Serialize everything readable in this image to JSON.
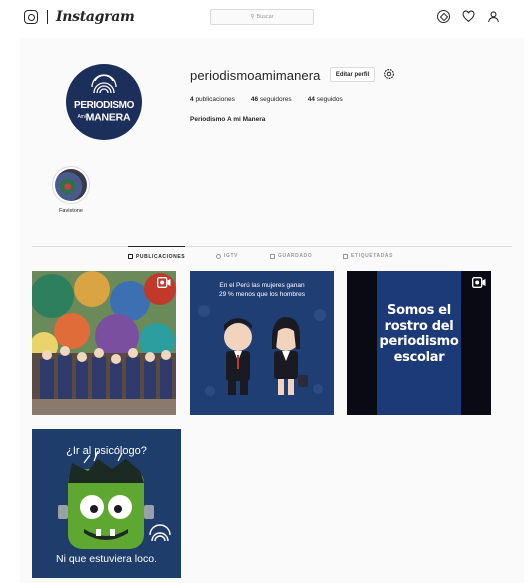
{
  "nav": {
    "wordmark": "Instagram",
    "search_placeholder": "Buscar",
    "icons": [
      "camera-icon",
      "compass-icon",
      "heart-icon",
      "person-icon"
    ]
  },
  "profile": {
    "username": "periodismoamimanera",
    "edit_label": "Editar perfil",
    "stats": {
      "posts_count": "4",
      "posts_label": "publicaciones",
      "followers_count": "46",
      "followers_label": "seguidores",
      "following_count": "44",
      "following_label": "seguidos"
    },
    "full_name": "Periodismo A mi Manera",
    "avatar": {
      "line1": "PERIODISMO",
      "line2_small_a": "A",
      "line2_small_mi": "mi",
      "line2": "MANERA"
    }
  },
  "highlights": [
    {
      "label": "Favistone"
    }
  ],
  "tabs": [
    {
      "label": "PUBLICACIONES",
      "active": true
    },
    {
      "label": "IGTV",
      "active": false
    },
    {
      "label": "GUARDADO",
      "active": false
    },
    {
      "label": "ETIQUETADAS",
      "active": false
    }
  ],
  "posts": [
    {
      "kind": "photo"
    },
    {
      "kind": "illustration",
      "line1": "En el Perú  las mujeres ganan",
      "line2": "29 % menos que los hombres"
    },
    {
      "kind": "video",
      "line1": "Somos el",
      "line2": "rostro del",
      "line3": "periodismo",
      "line4": "escolar"
    },
    {
      "kind": "illustration",
      "top": "¿Ir al psicólogo?",
      "bottom": "Ni que estuviera loco."
    }
  ],
  "colors": {
    "background": "#fafafa",
    "accent_navy": "#1c2e5a",
    "border": "#dbdbdb"
  }
}
